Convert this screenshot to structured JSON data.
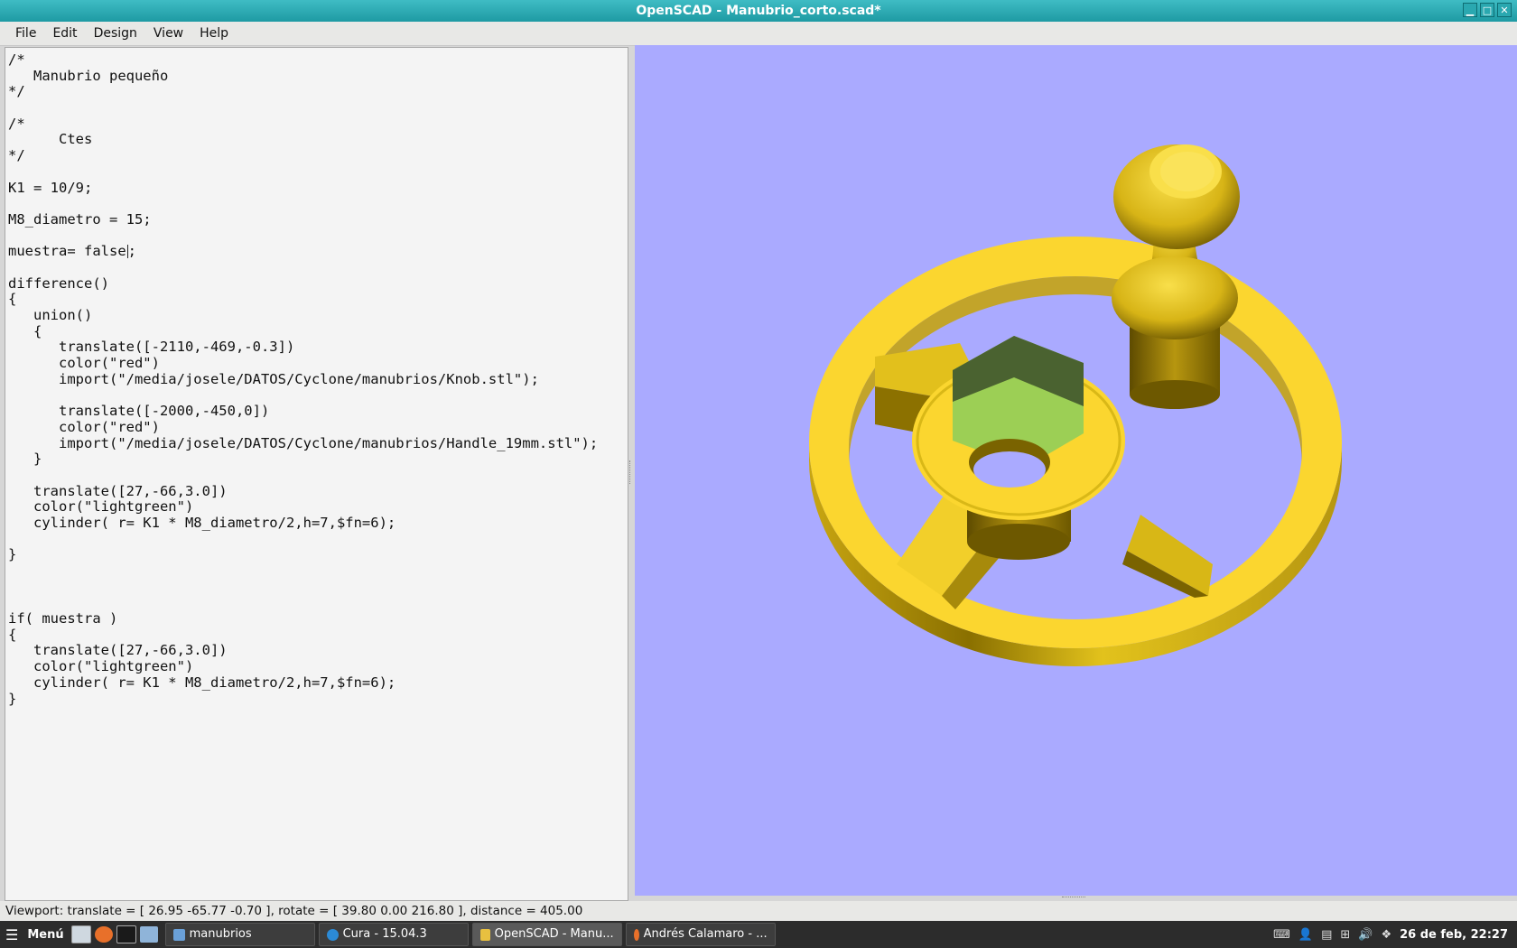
{
  "window": {
    "title": "OpenSCAD - Manubrio_corto.scad*"
  },
  "window_buttons": [
    "▁",
    "□",
    "✕"
  ],
  "menubar": [
    "File",
    "Edit",
    "Design",
    "View",
    "Help"
  ],
  "editor": {
    "lines": [
      "/*",
      "   Manubrio pequeño",
      "*/",
      "",
      "/*",
      "      Ctes",
      "*/",
      "",
      "K1 = 10/9;",
      "",
      "M8_diametro = 15;",
      "",
      "muestra= false;",
      "",
      "difference()",
      "{",
      "   union()",
      "   {",
      "      translate([-2110,-469,-0.3])",
      "      color(\"red\")",
      "      import(\"/media/josele/DATOS/Cyclone/manubrios/Knob.stl\");",
      "",
      "      translate([-2000,-450,0])",
      "      color(\"red\")",
      "      import(\"/media/josele/DATOS/Cyclone/manubrios/Handle_19mm.stl\");",
      "   }",
      "",
      "   translate([27,-66,3.0])",
      "   color(\"lightgreen\")",
      "   cylinder( r= K1 * M8_diametro/2,h=7,$fn=6);",
      "",
      "}",
      "",
      "",
      "",
      "if( muestra )",
      "{",
      "   translate([27,-66,3.0])",
      "   color(\"lightgreen\")",
      "   cylinder( r= K1 * M8_diametro/2,h=7,$fn=6);",
      "}"
    ]
  },
  "viewport": {
    "background": "#aaaaff",
    "model_color": "#f5d637",
    "hex_color": "#9ccf55"
  },
  "statusbar": {
    "text": "Viewport: translate = [ 26.95 -65.77 -0.70 ], rotate = [ 39.80 0.00 216.80 ], distance = 405.00"
  },
  "taskbar": {
    "menu_label": "Menú",
    "tasks": [
      {
        "label": "manubrios",
        "icon": "folder-icon",
        "color": "#6aa0d8"
      },
      {
        "label": "Cura - 15.04.3",
        "icon": "cura-icon",
        "color": "#2b8ad6"
      },
      {
        "label": "OpenSCAD - Manu...",
        "icon": "openscad-icon",
        "color": "#e8c040"
      },
      {
        "label": "Andrés Calamaro - ...",
        "icon": "firefox-icon",
        "color": "#e8702a"
      }
    ],
    "clock": "26 de feb, 22:27"
  }
}
